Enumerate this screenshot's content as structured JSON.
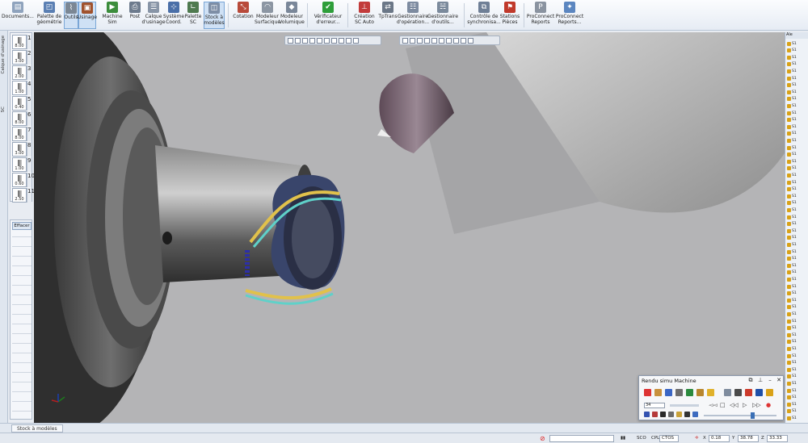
{
  "ribbon": {
    "items": [
      {
        "label": "Documents..."
      },
      {
        "label": "Palette de géométrie"
      },
      {
        "label": "Outils"
      },
      {
        "label": "Usinage"
      },
      {
        "label": "Machine Sim"
      },
      {
        "label": "Post"
      },
      {
        "label": "Calque d'usinage"
      },
      {
        "label": "Système Coord."
      },
      {
        "label": "Palette SC"
      },
      {
        "label": "Stock à modèles"
      },
      {
        "label": "Cotation"
      },
      {
        "label": "Modeleur Surfacique"
      },
      {
        "label": "Modeleur Volumique"
      },
      {
        "label": "Vérificateur d'erreur..."
      },
      {
        "label": "Création SC Auto"
      },
      {
        "label": "TpTrans"
      },
      {
        "label": "Gestionnaire d'opération..."
      },
      {
        "label": "Gestionnaire d'outils..."
      },
      {
        "label": "Contrôle de synchronisa..."
      },
      {
        "label": "Stations Pièces"
      },
      {
        "label": "ProConnect Reports"
      },
      {
        "label": "ProConnect Reports..."
      }
    ]
  },
  "left": {
    "tab1": "Calque d'usinage",
    "tab2": "SC",
    "tools": [
      {
        "number": "1",
        "value": "8.00"
      },
      {
        "number": "2",
        "value": "3.00"
      },
      {
        "number": "3",
        "value": "2.00"
      },
      {
        "number": "4",
        "value": "1.00"
      },
      {
        "number": "5",
        "value": "0.40"
      },
      {
        "number": "6",
        "value": "8.00"
      },
      {
        "number": "7",
        "value": "8.00"
      },
      {
        "number": "8",
        "value": "3.00"
      },
      {
        "number": "9",
        "value": "1.00"
      },
      {
        "number": "10",
        "value": "0.60"
      },
      {
        "number": "11",
        "value": "2.50"
      }
    ],
    "effacer_label": "Effacer"
  },
  "right_list": {
    "header": "Ale",
    "items": [
      "S1",
      "S1",
      "S1",
      "S1",
      "S1",
      "S1",
      "S1",
      "S1",
      "S1",
      "S1",
      "S1",
      "S1",
      "S1",
      "S1",
      "S1",
      "S1",
      "S1",
      "S1",
      "S1",
      "S1",
      "S1",
      "S1",
      "S1",
      "S1",
      "S1",
      "S1",
      "S1",
      "S1",
      "S1",
      "S1",
      "S1",
      "S1",
      "S1",
      "S1",
      "S1",
      "S1",
      "S1",
      "S1",
      "S1",
      "S1",
      "S1",
      "S1",
      "S1",
      "S1",
      "S1",
      "S1",
      "S1",
      "S1",
      "S1",
      "S1",
      "S1",
      "S1",
      "S1",
      "S1",
      "S1"
    ]
  },
  "bottom": {
    "tab_label": "Stock à modèles"
  },
  "simu": {
    "title": "Rendu simu Machine",
    "step_value": "34"
  },
  "status": {
    "sc_label": "SCO",
    "cplan_label": "CPL",
    "cplan_value": "CTOS",
    "x_label": "X",
    "x_value": "0.18",
    "y_label": "Y",
    "y_value": "38.78",
    "z_label": "Z",
    "z_value": "33.33"
  },
  "colors": {
    "viewport_bg": "#b4b4b6",
    "ribbon_bg": "#eef2f7",
    "accent": "#3a6fb5"
  }
}
